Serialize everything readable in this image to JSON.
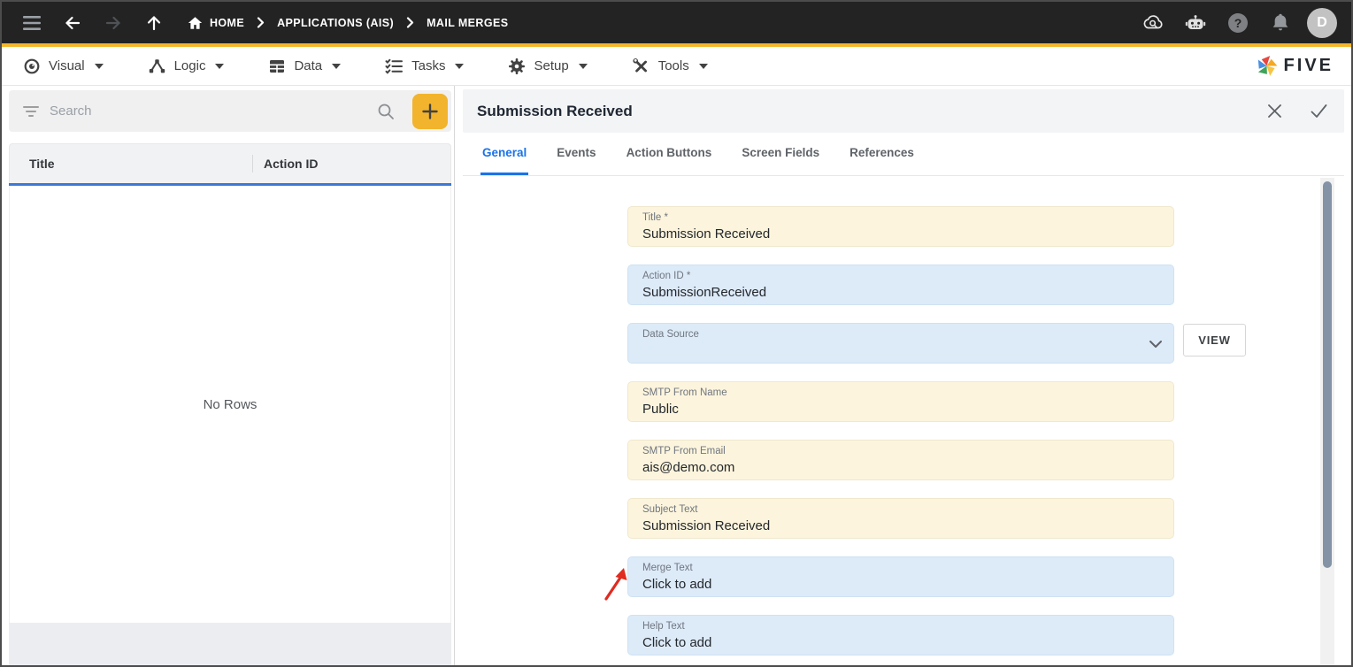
{
  "topbar": {
    "breadcrumb": [
      {
        "label": "HOME"
      },
      {
        "label": "APPLICATIONS (AIS)"
      },
      {
        "label": "MAIL MERGES"
      }
    ],
    "avatar_initial": "D"
  },
  "menubar": {
    "items": [
      {
        "label": "Visual"
      },
      {
        "label": "Logic"
      },
      {
        "label": "Data"
      },
      {
        "label": "Tasks"
      },
      {
        "label": "Setup"
      },
      {
        "label": "Tools"
      }
    ],
    "logo_text": "FIVE"
  },
  "left_panel": {
    "search": {
      "placeholder": "Search"
    },
    "table": {
      "columns": [
        "Title",
        "Action ID"
      ],
      "empty_text": "No Rows"
    }
  },
  "form_panel": {
    "title": "Submission Received",
    "tabs": [
      {
        "label": "General",
        "active": true
      },
      {
        "label": "Events",
        "active": false
      },
      {
        "label": "Action Buttons",
        "active": false
      },
      {
        "label": "Screen Fields",
        "active": false
      },
      {
        "label": "References",
        "active": false
      }
    ],
    "view_button": "VIEW",
    "fields": [
      {
        "label": "Title *",
        "value": "Submission Received"
      },
      {
        "label": "Action ID *",
        "value": "SubmissionReceived"
      },
      {
        "label": "Data Source",
        "value": ""
      },
      {
        "label": "SMTP From Name",
        "value": "Public"
      },
      {
        "label": "SMTP From Email",
        "value": "ais@demo.com"
      },
      {
        "label": "Subject Text",
        "value": "Submission Received"
      },
      {
        "label": "Merge Text",
        "value": "Click to add"
      },
      {
        "label": "Help Text",
        "value": "Click to add"
      }
    ]
  },
  "colors": {
    "topbar_bg": "#232323",
    "accent_amber": "#f5b62b",
    "tab_active_blue": "#1a73e8",
    "grid_header_blue": "#3b78d8",
    "field_cream_bg": "#fcf4dc",
    "field_blue_bg": "#ddeaf8",
    "annotation_red": "#e02b20",
    "scroll_thumb": "#8493a5"
  }
}
